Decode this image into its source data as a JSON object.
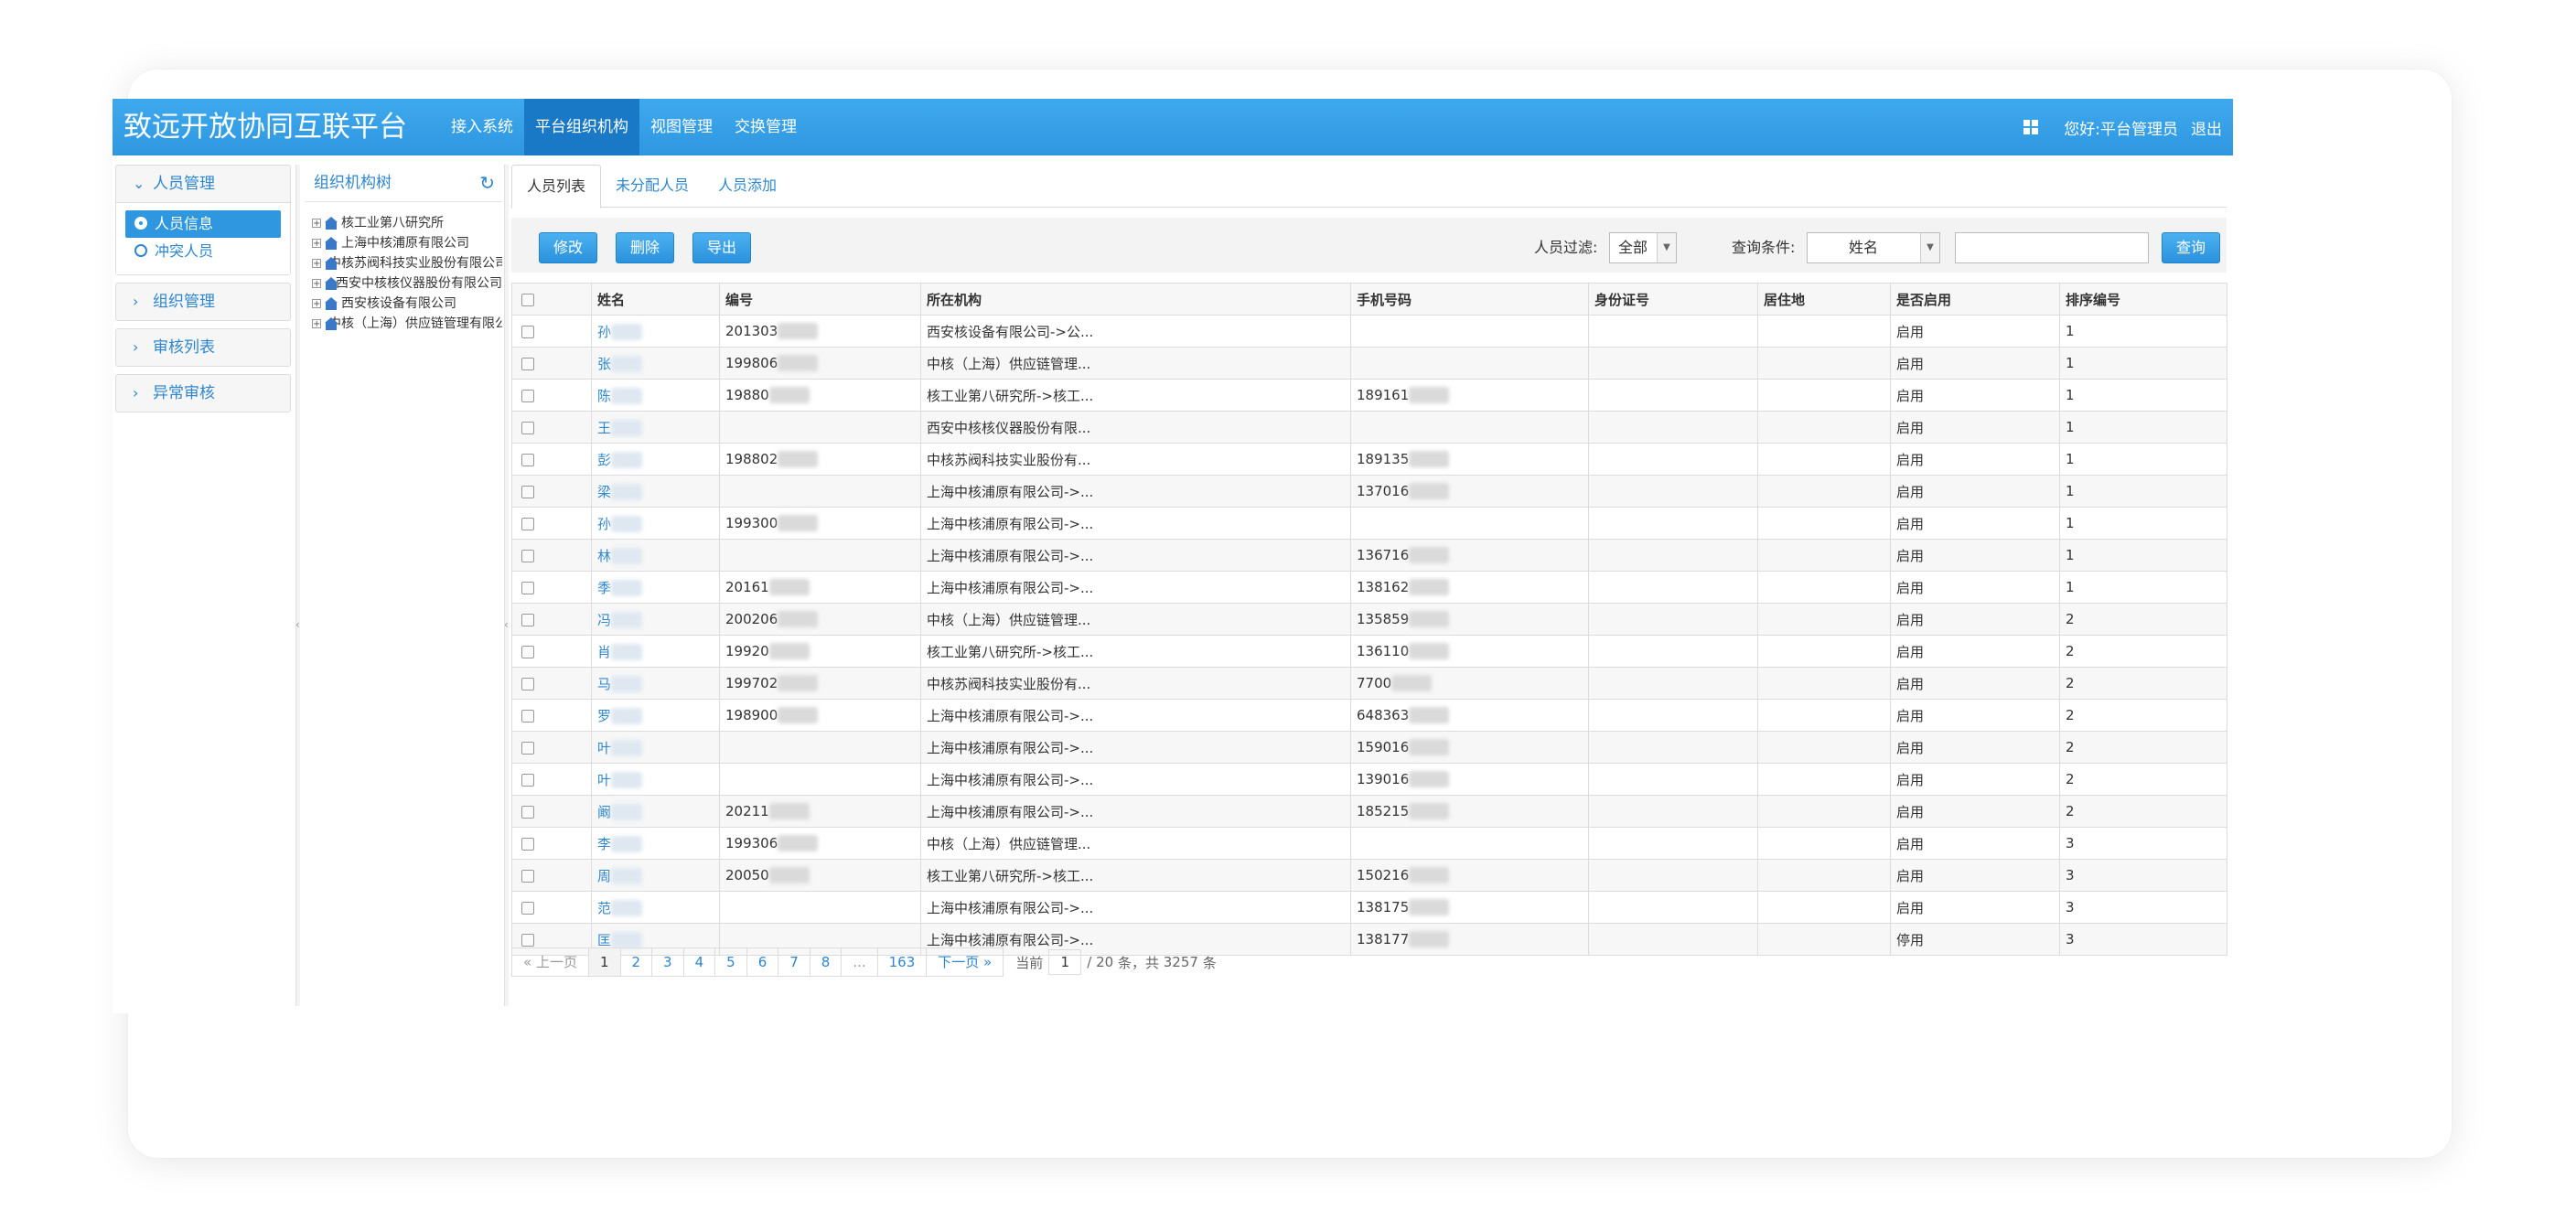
{
  "header": {
    "brand": "致远开放协同互联平台",
    "nav": [
      "接入系统",
      "平台组织机构",
      "视图管理",
      "交换管理"
    ],
    "active_nav": 1,
    "greeting": "您好:平台管理员",
    "logout": "退出"
  },
  "leftmenu": {
    "groups": [
      {
        "label": "人员管理",
        "expanded": true,
        "items": [
          {
            "label": "人员信息",
            "active": true
          },
          {
            "label": "冲突人员",
            "active": false
          }
        ]
      },
      {
        "label": "组织管理"
      },
      {
        "label": "审核列表"
      },
      {
        "label": "异常审核"
      }
    ]
  },
  "tree": {
    "title": "组织机构树",
    "nodes": [
      "核工业第八研究所",
      "上海中核浦原有限公司",
      "中核苏阀科技实业股份有限公司",
      "西安中核核仪器股份有限公司",
      "西安核设备有限公司",
      "中核（上海）供应链管理有限公司"
    ]
  },
  "tabs": [
    "人员列表",
    "未分配人员",
    "人员添加"
  ],
  "toolbar": {
    "edit": "修改",
    "delete": "删除",
    "export": "导出",
    "filter_label": "人员过滤:",
    "filter_value": "全部",
    "query_label": "查询条件:",
    "query_field": "姓名",
    "search": "查询"
  },
  "table": {
    "columns": [
      "姓名",
      "编号",
      "所在机构",
      "手机号码",
      "身份证号",
      "居住地",
      "是否启用",
      "排序编号"
    ],
    "rows": [
      {
        "name": "孙",
        "code": "201303",
        "org": "西安核设备有限公司->公...",
        "phone": "",
        "enabled": "启用",
        "order": "1"
      },
      {
        "name": "张",
        "code": "199806",
        "org": "中核（上海）供应链管理...",
        "phone": "",
        "enabled": "启用",
        "order": "1"
      },
      {
        "name": "陈",
        "code": "19880",
        "org": "核工业第八研究所->核工...",
        "phone": "189161",
        "enabled": "启用",
        "order": "1"
      },
      {
        "name": "王",
        "code": "",
        "org": "西安中核核仪器股份有限...",
        "phone": "",
        "enabled": "启用",
        "order": "1"
      },
      {
        "name": "彭",
        "code": "198802",
        "org": "中核苏阀科技实业股份有...",
        "phone": "189135",
        "enabled": "启用",
        "order": "1"
      },
      {
        "name": "梁",
        "code": "",
        "org": "上海中核浦原有限公司->...",
        "phone": "137016",
        "enabled": "启用",
        "order": "1"
      },
      {
        "name": "孙",
        "code": "199300",
        "org": "上海中核浦原有限公司->...",
        "phone": "",
        "enabled": "启用",
        "order": "1"
      },
      {
        "name": "林",
        "code": "",
        "org": "上海中核浦原有限公司->...",
        "phone": "136716",
        "enabled": "启用",
        "order": "1"
      },
      {
        "name": "季",
        "code": "20161",
        "org": "上海中核浦原有限公司->...",
        "phone": "138162",
        "enabled": "启用",
        "order": "1"
      },
      {
        "name": "冯",
        "code": "200206",
        "org": "中核（上海）供应链管理...",
        "phone": "135859",
        "enabled": "启用",
        "order": "2"
      },
      {
        "name": "肖",
        "code": "19920",
        "org": "核工业第八研究所->核工...",
        "phone": "136110",
        "enabled": "启用",
        "order": "2"
      },
      {
        "name": "马",
        "code": "199702",
        "org": "中核苏阀科技实业股份有...",
        "phone": "7700",
        "enabled": "启用",
        "order": "2"
      },
      {
        "name": "罗",
        "code": "198900",
        "org": "上海中核浦原有限公司->...",
        "phone": "648363",
        "enabled": "启用",
        "order": "2"
      },
      {
        "name": "叶",
        "code": "",
        "org": "上海中核浦原有限公司->...",
        "phone": "159016",
        "enabled": "启用",
        "order": "2"
      },
      {
        "name": "叶",
        "code": "",
        "org": "上海中核浦原有限公司->...",
        "phone": "139016",
        "enabled": "启用",
        "order": "2"
      },
      {
        "name": "阚",
        "code": "20211",
        "org": "上海中核浦原有限公司->...",
        "phone": "185215",
        "enabled": "启用",
        "order": "2"
      },
      {
        "name": "李",
        "code": "199306",
        "org": "中核（上海）供应链管理...",
        "phone": "",
        "enabled": "启用",
        "order": "3"
      },
      {
        "name": "周",
        "code": "20050",
        "org": "核工业第八研究所->核工...",
        "phone": "150216",
        "enabled": "启用",
        "order": "3"
      },
      {
        "name": "范",
        "code": "",
        "org": "上海中核浦原有限公司->...",
        "phone": "138175",
        "enabled": "启用",
        "order": "3"
      },
      {
        "name": "匡",
        "code": "",
        "org": "上海中核浦原有限公司->...",
        "phone": "138177",
        "enabled": "停用",
        "order": "3"
      }
    ]
  },
  "pager": {
    "prev": "« 上一页",
    "pages": [
      "1",
      "2",
      "3",
      "4",
      "5",
      "6",
      "7",
      "8",
      "...",
      "163"
    ],
    "next": "下一页 »",
    "current_label": "当前",
    "current": "1",
    "sep": "/",
    "total_pages": "20",
    "unit": "条，共",
    "total": "3257",
    "total_unit": "条"
  },
  "colors": {
    "header": "#2e97e0",
    "active_nav": "#1a79c7",
    "link": "#2d86d0",
    "button": "#2a92dc"
  }
}
